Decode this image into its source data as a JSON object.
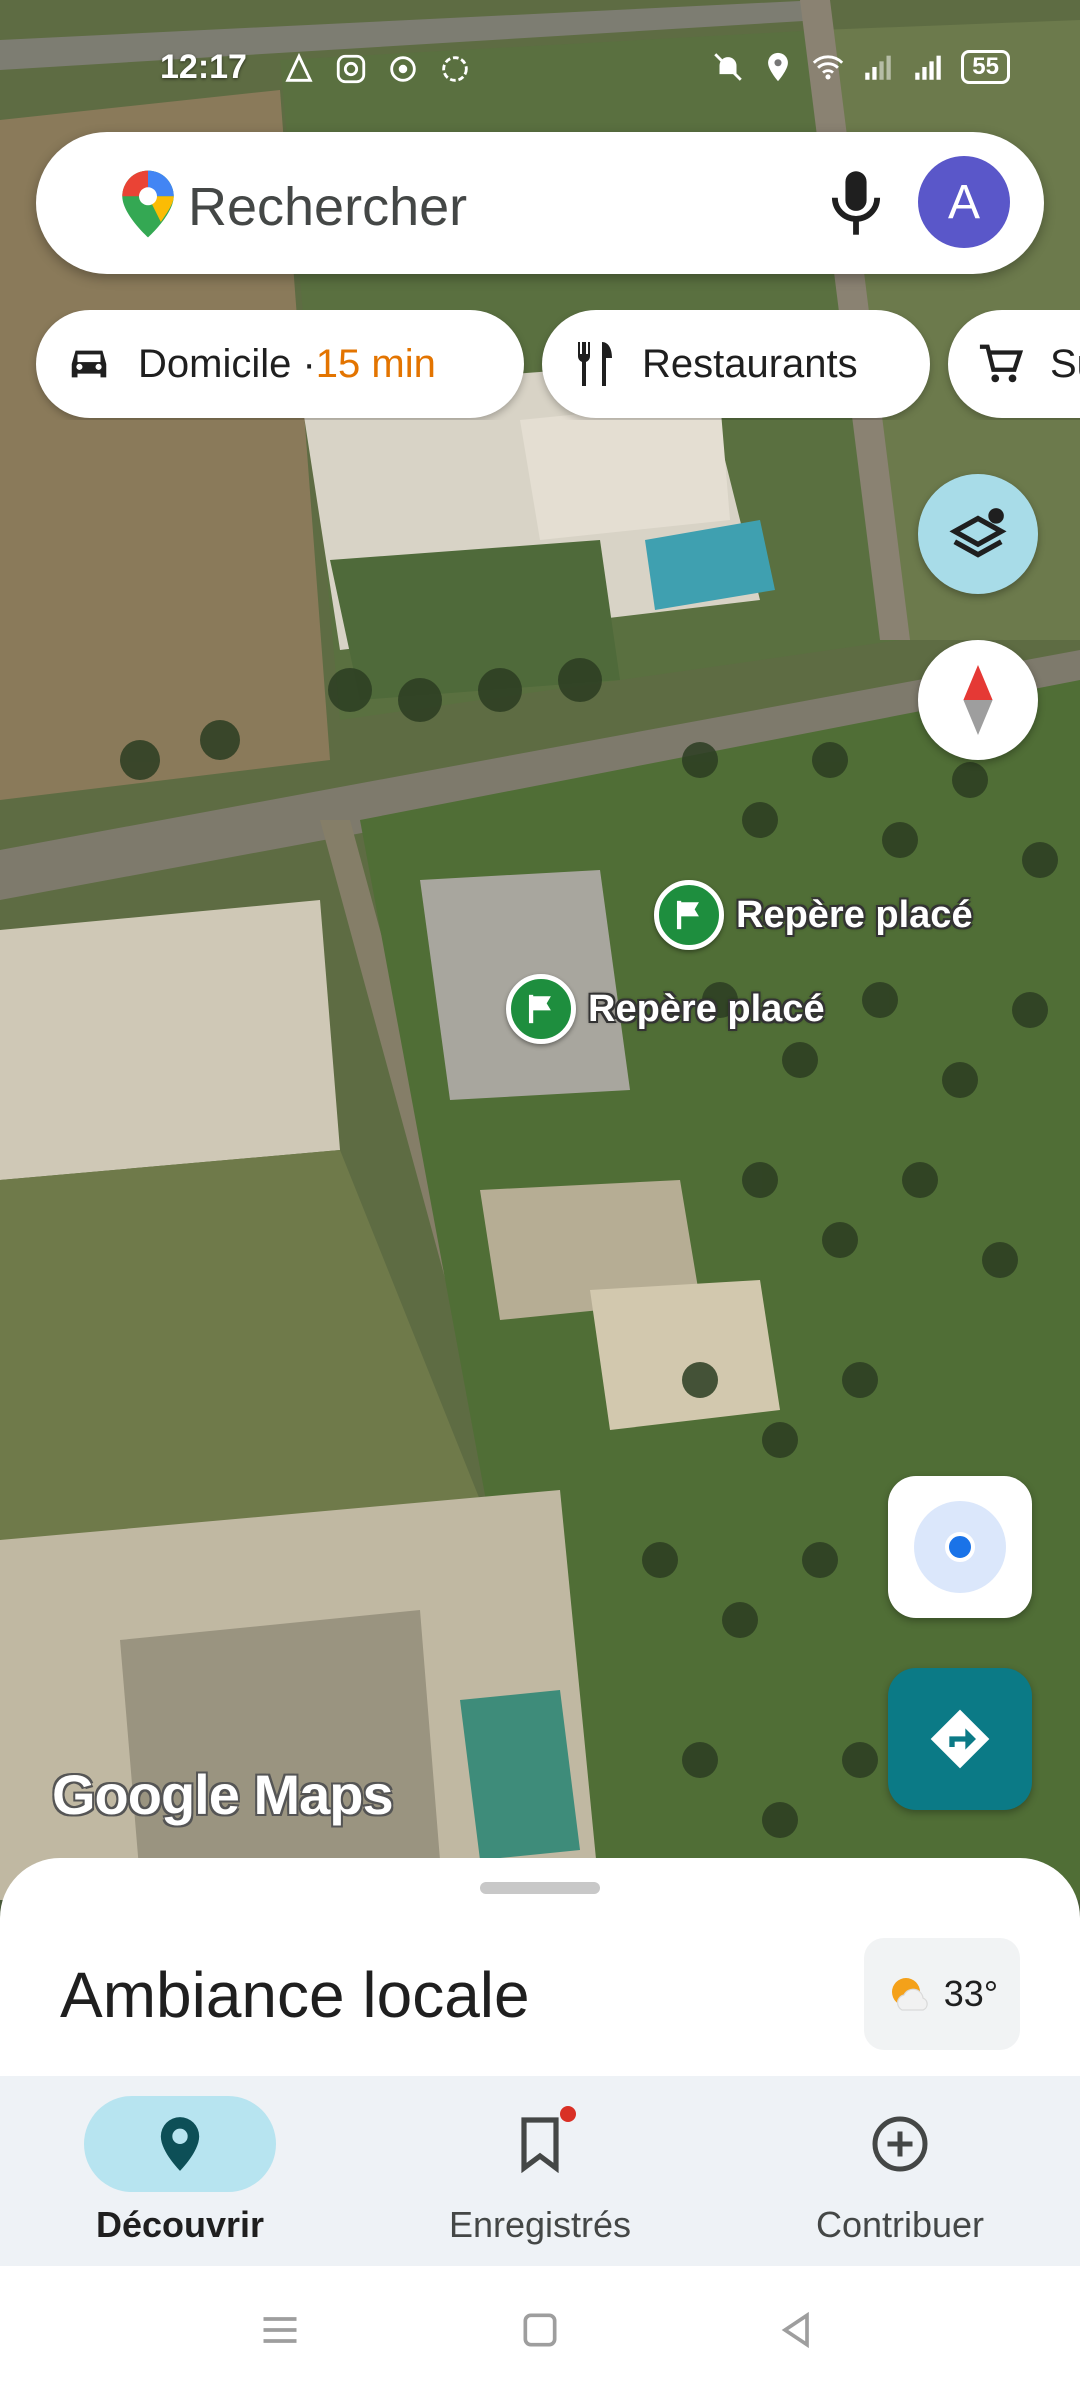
{
  "status_bar": {
    "time": "12:17",
    "battery": "55"
  },
  "search": {
    "placeholder": "Rechercher",
    "avatar_letter": "A"
  },
  "chips": [
    {
      "label": "Domicile · ",
      "accent": "15 min",
      "icon": "car-icon"
    },
    {
      "label": "Restaurants",
      "icon": "utensils-icon"
    },
    {
      "label": "Su",
      "icon": "cart-icon"
    }
  ],
  "markers": [
    {
      "label": "Repère placé"
    },
    {
      "label": "Repère placé"
    }
  ],
  "watermark": "Google Maps",
  "sheet": {
    "title": "Ambiance locale",
    "temperature": "33°"
  },
  "bottom_nav": [
    {
      "label": "Découvrir",
      "active": true
    },
    {
      "label": "Enregistrés",
      "active": false
    },
    {
      "label": "Contribuer",
      "active": false
    }
  ],
  "colors": {
    "accent_orange": "#e37400",
    "marker_green": "#1e8e3e",
    "directions_teal": "#0b7a86",
    "active_pill": "#b7e4f0",
    "avatar": "#5a57c9"
  }
}
